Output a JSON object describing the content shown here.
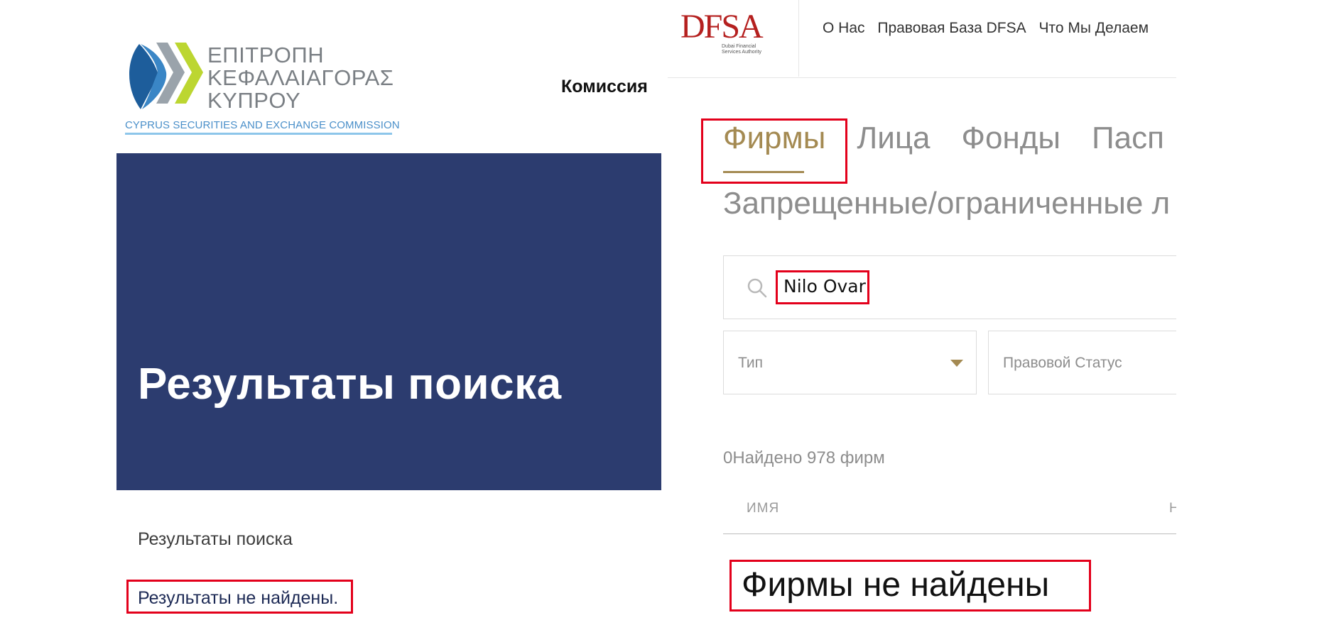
{
  "left_panel": {
    "logo": {
      "greek_lines": [
        "ΕΠΙΤΡΟΠΗ",
        "ΚΕΦΑΛΑΙΑΓΟΡΑΣ",
        "ΚΥΠΡΟΥ"
      ],
      "english": "CYPRUS SECURITIES AND EXCHANGE COMMISSION"
    },
    "nav_commission": "Комиссия",
    "hero_title": "Результаты поиска",
    "breadcrumb": "Результаты поиска",
    "no_results": "Результаты не найдены."
  },
  "right_panel": {
    "logo": {
      "mark": "DFSA",
      "sub_line1": "Dubai Financial",
      "sub_line2": "Services Authority"
    },
    "nav": [
      "О Нас",
      "Правовая База DFSA",
      "Что Мы Делаем"
    ],
    "tabs": [
      "Фирмы",
      "Лица",
      "Фонды",
      "Пасп"
    ],
    "subtab": "Запрещенные/ограниченные л",
    "search_value": "Nilo Ovar",
    "filter_type": "Тип",
    "filter_status": "Правовой Статус",
    "result_count": "0Найдено 978 фирм",
    "column_name": "ИМЯ",
    "column_cut": "Н",
    "no_firms": "Фирмы не найдены"
  },
  "colors": {
    "hero_bg": "#2c3c6f",
    "highlight_box": "#e3001b",
    "gold_accent": "#a48a52",
    "dfsa_red": "#b5201f"
  }
}
